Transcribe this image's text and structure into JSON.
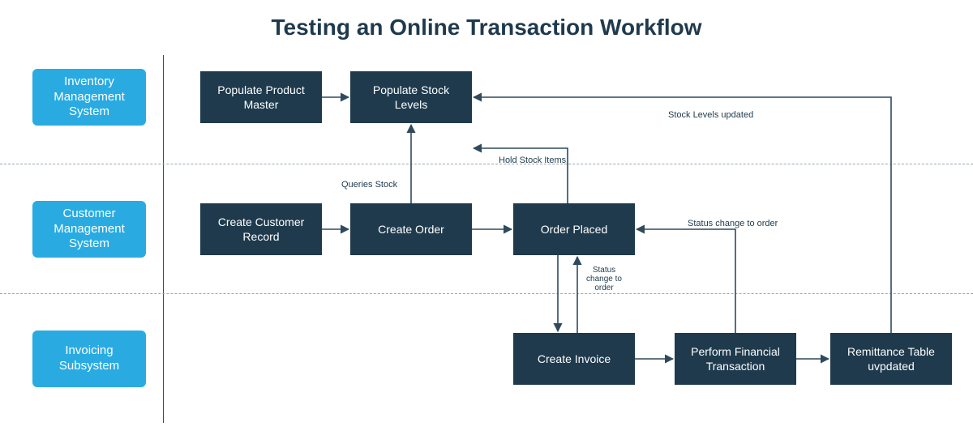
{
  "title": "Testing an Online Transaction Workflow",
  "lanes": {
    "inventory": "Inventory Management System",
    "customer": "Customer Management System",
    "invoicing": "Invoicing Subsystem"
  },
  "nodes": {
    "populate_product_master": "Populate Product Master",
    "populate_stock_levels": "Populate Stock Levels",
    "create_customer_record": "Create Customer Record",
    "create_order": "Create Order",
    "order_placed": "Order Placed",
    "create_invoice": "Create Invoice",
    "perform_financial_transaction": "Perform Financial Transaction",
    "remittance_table_updated": "Remittance Table uvpdated"
  },
  "edge_labels": {
    "queries_stock": "Queries Stock",
    "hold_stock_items": "Hold Stock Items",
    "stock_levels_updated": "Stock Levels updated",
    "status_change_to_order_right": "Status change to order",
    "status_change_to_order_vert": "Status change to order"
  },
  "colors": {
    "title": "#1f3a4d",
    "lane_bg": "#29abe2",
    "node_bg": "#1f3a4d",
    "connector": "#2f4a5d",
    "dash": "#9aa8b3"
  }
}
